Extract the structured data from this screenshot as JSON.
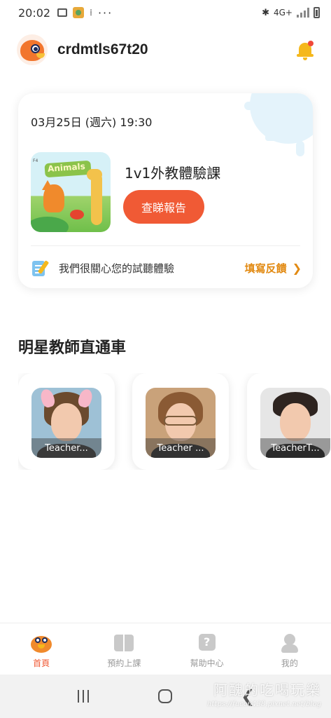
{
  "status_bar": {
    "time": "20:02",
    "dots": "···",
    "network": "4G+"
  },
  "header": {
    "username": "crdmtls67t20"
  },
  "lesson_card": {
    "date": "03月25日 (週六) 19:30",
    "thumbnail_text": "Animals",
    "thumbnail_tag": "F4",
    "title": "1v1外教體驗課",
    "report_button": "查睇報告",
    "feedback_text": "我們很關心您的試聽體驗",
    "feedback_link": "填寫反饋",
    "chevron": "❯"
  },
  "teachers_section": {
    "title": "明星教師直通車",
    "teachers": [
      {
        "name": "Teacher...",
        "hair_color": "#6b4a2e",
        "bg": "#9ec1d6",
        "shirt": "#3a3a3a"
      },
      {
        "name": "Teacher ...",
        "hair_color": "#8a5a34",
        "bg": "#c9a27a",
        "shirt": "#2b2b2b"
      },
      {
        "name": "TeacherT...",
        "hair_color": "#2e2420",
        "bg": "#e6e6e6",
        "shirt": "#1e1e1e"
      }
    ]
  },
  "bottom_nav": {
    "items": [
      {
        "label": "首頁",
        "active": true
      },
      {
        "label": "預約上課",
        "active": false
      },
      {
        "label": "幫助中心",
        "active": false
      },
      {
        "label": "我的",
        "active": false
      }
    ],
    "help_glyph": "?"
  },
  "system_nav": {
    "back_glyph": "❮"
  },
  "watermark": {
    "line1": "阿醜的吃喝玩樂",
    "line2": "https://fuco6438.pixnet.net/blog"
  },
  "colors": {
    "accent": "#f05a35",
    "link": "#e28a12",
    "bell": "#f5b81c"
  }
}
